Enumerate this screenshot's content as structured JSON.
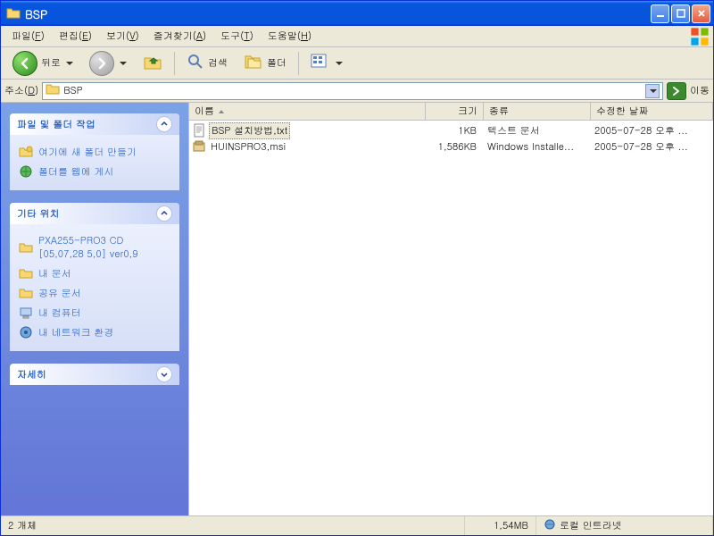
{
  "window": {
    "title": "BSP"
  },
  "menu": {
    "file": "파일",
    "file_accel": "F",
    "edit": "편집",
    "edit_accel": "E",
    "view": "보기",
    "view_accel": "V",
    "fav": "즐겨찾기",
    "fav_accel": "A",
    "tools": "도구",
    "tools_accel": "T",
    "help": "도움말",
    "help_accel": "H"
  },
  "toolbar": {
    "back": "뒤로",
    "search": "검색",
    "folders": "폴더"
  },
  "address": {
    "label": "주소",
    "label_accel": "D",
    "path": "BSP",
    "go": "이동"
  },
  "sidepanel": {
    "task": {
      "title": "파일 및 폴더 작업",
      "links": [
        {
          "icon": "new-folder-icon",
          "label": "여기에 새 폴더 만들기"
        },
        {
          "icon": "web-publish-icon",
          "label": "폴더를 웹에 게시"
        }
      ]
    },
    "other": {
      "title": "기타 위치",
      "links": [
        {
          "icon": "folder-icon",
          "label": "PXA255-PRO3 CD [05,07,28 5,0] ver0,9"
        },
        {
          "icon": "folder-icon",
          "label": "내 문서"
        },
        {
          "icon": "folder-icon",
          "label": "공유 문서"
        },
        {
          "icon": "computer-icon",
          "label": "내 컴퓨터"
        },
        {
          "icon": "network-icon",
          "label": "내 네트워크 환경"
        }
      ]
    },
    "details": {
      "title": "자세히"
    }
  },
  "columns": {
    "name": "이름",
    "size": "크기",
    "type": "종류",
    "date": "수정한 날짜"
  },
  "files": [
    {
      "icon": "text-file-icon",
      "name": "BSP 설치방법,txt",
      "size": "1KB",
      "type": "텍스트 문서",
      "date": "2005-07-28 오후 ...",
      "selected": true
    },
    {
      "icon": "msi-file-icon",
      "name": "HUINSPRO3,msi",
      "size": "1,586KB",
      "type": "Windows Installe...",
      "date": "2005-07-28 오후 ...",
      "selected": false
    }
  ],
  "status": {
    "count": "2 개체",
    "size": "1,54MB",
    "zone": "로컬 인트라넷"
  }
}
